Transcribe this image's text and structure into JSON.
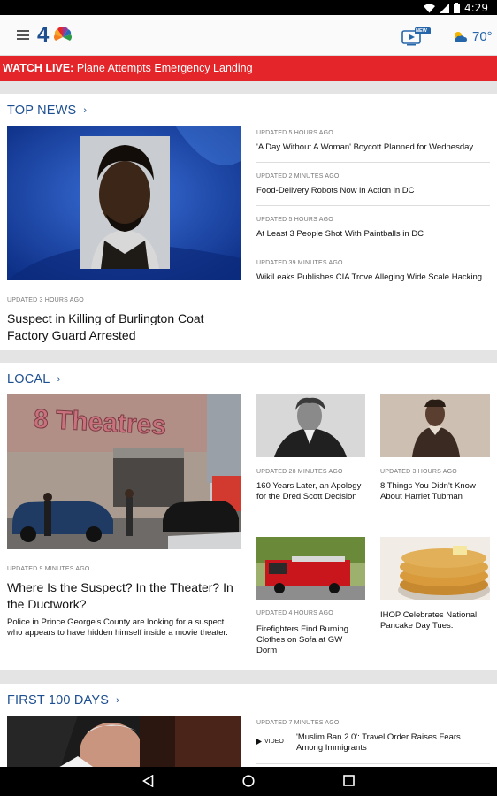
{
  "status_bar": {
    "time": "4:29"
  },
  "app_bar": {
    "tv_badge": "NEW",
    "temperature": "70°"
  },
  "live_banner": {
    "prefix": "WATCH LIVE:",
    "text": "Plane Attempts Emergency Landing"
  },
  "top_news": {
    "title": "TOP NEWS",
    "feature": {
      "updated": "UPDATED 3 HOURS AGO",
      "headline": "Suspect in Killing of Burlington Coat Factory Guard Arrested"
    },
    "list": [
      {
        "updated": "UPDATED 5 HOURS AGO",
        "headline": "'A Day Without A Woman' Boycott Planned for Wednesday"
      },
      {
        "updated": "UPDATED 2 MINUTES AGO",
        "headline": "Food-Delivery Robots Now in Action in DC"
      },
      {
        "updated": "UPDATED 5 HOURS AGO",
        "headline": "At Least 3 People Shot With Paintballs in DC"
      },
      {
        "updated": "UPDATED 39 MINUTES AGO",
        "headline": "WikiLeaks Publishes CIA Trove Alleging Wide Scale Hacking"
      }
    ]
  },
  "local": {
    "title": "LOCAL",
    "feature": {
      "image_sign": "8 Theatres",
      "updated": "UPDATED 9 MINUTES AGO",
      "headline": "Where Is the Suspect? In the Theater? In the Ductwork?",
      "summary": "Police in Prince George's County are looking for a suspect who appears to have hidden himself inside a movie theater."
    },
    "cards": [
      {
        "updated": "UPDATED 28 MINUTES AGO",
        "headline": "160 Years Later, an Apology for the Dred Scott Decision"
      },
      {
        "updated": "UPDATED 3 HOURS AGO",
        "headline": "8 Things You Didn't Know About Harriet Tubman"
      },
      {
        "updated": "UPDATED 4 HOURS AGO",
        "headline": "Firefighters Find Burning Clothes on Sofa at GW Dorm"
      },
      {
        "updated": "",
        "headline": "IHOP Celebrates National Pancake Day Tues."
      }
    ]
  },
  "first_100": {
    "title": "FIRST 100 DAYS",
    "list": [
      {
        "updated": "UPDATED 7 MINUTES AGO",
        "badge": "VIDEO",
        "headline": "'Muslim Ban 2.0': Travel Order Raises Fears Among Immigrants"
      }
    ]
  },
  "icons": {
    "menu": "hamburger-menu-icon",
    "logo": "nbc4-logo",
    "tv": "live-tv-icon",
    "weather": "partly-cloudy-icon",
    "chevron": "chevron-right-icon",
    "play": "play-icon",
    "back": "back-triangle-icon",
    "home": "home-circle-icon",
    "recents": "recents-square-icon"
  },
  "colors": {
    "accent_blue": "#1d4f91",
    "banner_red": "#e42529",
    "temperature_blue": "#2565a9"
  }
}
